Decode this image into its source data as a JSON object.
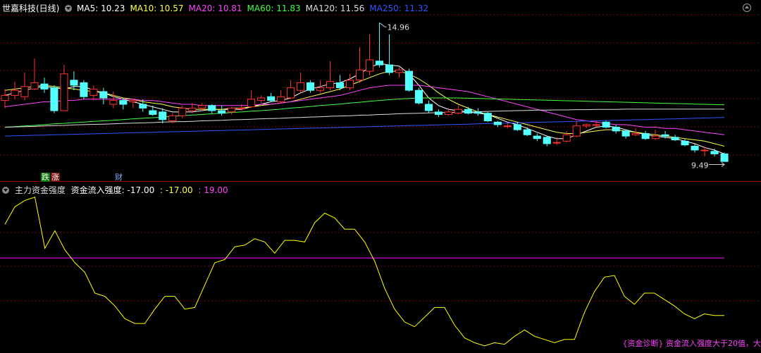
{
  "header_top": {
    "stock": "世嘉科技(日线)",
    "ma": [
      {
        "label": "MA5: 10.23",
        "color": "#ffffff"
      },
      {
        "label": "MA10: 10.57",
        "color": "#ffff44"
      },
      {
        "label": "MA20: 10.81",
        "color": "#ff44ff"
      },
      {
        "label": "MA60: 11.83",
        "color": "#44ff44"
      },
      {
        "label": "MA120: 11.56",
        "color": "#dddddd"
      },
      {
        "label": "MA250: 11.32",
        "color": "#3355ff"
      }
    ]
  },
  "header_bottom": {
    "indicator": "主力资金强度",
    "line1": "资金流入强度: -17.00",
    "line2": ": -17.00",
    "line3": ": 19.00"
  },
  "tags": {
    "die": "跌",
    "zhang": "涨",
    "cai": "财"
  },
  "diagnosis": "{资金诊断} 资金流入强度大于20值，大",
  "colors": {
    "up": "#ff3232",
    "down": "#54ffff",
    "grid": "#800000",
    "flow": "#ffff00",
    "threshold": "#ff00ff"
  },
  "chart_data": [
    {
      "type": "candlestick",
      "high_label": "14.96",
      "low_label": "9.49",
      "ylim": [
        9.2,
        15.3
      ],
      "candles": [
        [
          11.9,
          12.1,
          12.35,
          11.6
        ],
        [
          12.1,
          12.3,
          12.65,
          11.95
        ],
        [
          12.05,
          12.45,
          13.0,
          11.9
        ],
        [
          12.35,
          12.6,
          13.55,
          12.3
        ],
        [
          12.55,
          12.35,
          12.8,
          12.2
        ],
        [
          12.4,
          11.5,
          12.5,
          11.4
        ],
        [
          11.5,
          12.95,
          13.3,
          11.5
        ],
        [
          12.7,
          12.5,
          13.05,
          12.3
        ],
        [
          12.6,
          12.05,
          12.7,
          11.95
        ],
        [
          12.1,
          12.35,
          12.5,
          11.9
        ],
        [
          12.25,
          12.0,
          12.4,
          11.75
        ],
        [
          11.75,
          11.9,
          12.25,
          11.6
        ],
        [
          11.9,
          11.75,
          12.0,
          11.55
        ],
        [
          11.85,
          11.9,
          11.95,
          11.6
        ],
        [
          11.75,
          11.6,
          11.95,
          11.45
        ],
        [
          11.5,
          11.35,
          11.7,
          11.3
        ],
        [
          11.45,
          11.15,
          11.6,
          11.0
        ],
        [
          11.1,
          11.3,
          11.4,
          11.0
        ],
        [
          11.3,
          11.6,
          11.7,
          11.2
        ],
        [
          11.5,
          11.6,
          11.8,
          11.4
        ],
        [
          11.6,
          11.7,
          11.8,
          11.5
        ],
        [
          11.7,
          11.5,
          11.75,
          11.4
        ],
        [
          11.5,
          11.4,
          11.7,
          11.3
        ],
        [
          11.45,
          11.6,
          11.65,
          11.35
        ],
        [
          11.6,
          11.6,
          11.75,
          11.5
        ],
        [
          11.65,
          11.95,
          12.3,
          11.6
        ],
        [
          11.9,
          12.0,
          12.1,
          11.8
        ],
        [
          12.05,
          11.9,
          12.2,
          11.85
        ],
        [
          11.85,
          12.05,
          12.3,
          11.8
        ],
        [
          12.0,
          12.4,
          12.7,
          11.95
        ],
        [
          12.3,
          12.6,
          13.0,
          12.2
        ],
        [
          12.6,
          12.3,
          12.7,
          12.2
        ],
        [
          12.3,
          12.4,
          12.7,
          12.2
        ],
        [
          12.4,
          12.65,
          13.45,
          12.3
        ],
        [
          12.6,
          12.4,
          12.9,
          12.3
        ],
        [
          12.4,
          12.7,
          12.95,
          12.3
        ],
        [
          12.7,
          13.1,
          14.0,
          12.6
        ],
        [
          13.05,
          13.5,
          14.5,
          12.9
        ],
        [
          13.45,
          13.3,
          14.96,
          13.2
        ],
        [
          13.3,
          13.0,
          14.5,
          12.9
        ],
        [
          13.0,
          13.1,
          13.2,
          12.8
        ],
        [
          13.05,
          12.3,
          13.15,
          12.25
        ],
        [
          12.3,
          11.8,
          12.4,
          11.75
        ],
        [
          11.75,
          11.5,
          11.9,
          11.4
        ],
        [
          11.45,
          11.35,
          11.55,
          11.25
        ],
        [
          11.35,
          11.45,
          11.6,
          11.3
        ],
        [
          11.4,
          11.55,
          11.7,
          11.35
        ],
        [
          11.55,
          11.4,
          11.65,
          11.35
        ],
        [
          11.45,
          11.4,
          11.6,
          11.3
        ],
        [
          11.4,
          11.1,
          11.45,
          11.05
        ],
        [
          11.05,
          10.95,
          11.1,
          10.85
        ],
        [
          10.9,
          10.9,
          11.05,
          10.8
        ],
        [
          10.95,
          10.75,
          11.05,
          10.7
        ],
        [
          10.75,
          10.55,
          10.85,
          10.5
        ],
        [
          10.5,
          10.4,
          10.6,
          10.3
        ],
        [
          10.45,
          10.2,
          10.5,
          10.1
        ],
        [
          10.25,
          10.25,
          10.45,
          10.15
        ],
        [
          10.3,
          10.55,
          10.7,
          10.25
        ],
        [
          10.5,
          10.9,
          11.1,
          10.45
        ],
        [
          10.9,
          10.95,
          11.0,
          10.8
        ],
        [
          10.95,
          10.95,
          11.1,
          10.85
        ],
        [
          11.05,
          10.85,
          11.1,
          10.8
        ],
        [
          10.85,
          10.7,
          10.95,
          10.6
        ],
        [
          10.7,
          10.5,
          10.75,
          10.4
        ],
        [
          10.55,
          10.6,
          10.8,
          10.5
        ],
        [
          10.6,
          10.4,
          10.7,
          10.35
        ],
        [
          10.4,
          10.5,
          10.75,
          10.35
        ],
        [
          10.55,
          10.5,
          10.7,
          10.4
        ],
        [
          10.45,
          10.35,
          10.55,
          10.3
        ],
        [
          10.3,
          10.15,
          10.4,
          10.1
        ],
        [
          10.1,
          9.95,
          10.2,
          9.85
        ],
        [
          9.95,
          9.95,
          10.1,
          9.7
        ],
        [
          9.9,
          9.8,
          10.0,
          9.7
        ],
        [
          9.8,
          9.5,
          9.85,
          9.49
        ]
      ],
      "ma_series": [
        {
          "name": "MA5",
          "color": "#ffffff",
          "values": [
            12.1,
            12.2,
            12.3,
            12.4,
            12.45,
            12.4,
            12.35,
            12.45,
            12.45,
            12.3,
            12.2,
            12.05,
            11.95,
            11.85,
            11.75,
            11.65,
            11.55,
            11.45,
            11.45,
            11.45,
            11.5,
            11.55,
            11.55,
            11.55,
            11.55,
            11.65,
            11.75,
            11.85,
            11.9,
            12.0,
            12.2,
            12.35,
            12.45,
            12.55,
            12.6,
            12.75,
            12.95,
            13.2,
            13.35,
            13.3,
            13.25,
            12.95,
            12.5,
            12.0,
            11.7,
            11.55,
            11.5,
            11.45,
            11.4,
            11.35,
            11.2,
            11.05,
            10.95,
            10.8,
            10.65,
            10.5,
            10.4,
            10.4,
            10.55,
            10.7,
            10.85,
            10.9,
            10.85,
            10.75,
            10.65,
            10.55,
            10.5,
            10.45,
            10.4,
            10.3,
            10.2,
            10.05,
            9.95,
            9.8
          ]
        },
        {
          "name": "MA10",
          "color": "#ffff44",
          "values": [
            12.3,
            12.35,
            12.4,
            12.45,
            12.5,
            12.45,
            12.4,
            12.35,
            12.3,
            12.25,
            12.2,
            12.1,
            12.0,
            11.95,
            11.85,
            11.8,
            11.75,
            11.65,
            11.6,
            11.55,
            11.55,
            11.55,
            11.55,
            11.6,
            11.6,
            11.65,
            11.7,
            11.75,
            11.8,
            11.85,
            11.95,
            12.05,
            12.15,
            12.25,
            12.35,
            12.5,
            12.65,
            12.8,
            12.95,
            13.05,
            13.05,
            12.95,
            12.75,
            12.5,
            12.2,
            11.95,
            11.75,
            11.6,
            11.45,
            11.35,
            11.25,
            11.15,
            11.05,
            10.95,
            10.85,
            10.75,
            10.65,
            10.6,
            10.6,
            10.65,
            10.7,
            10.75,
            10.75,
            10.7,
            10.65,
            10.6,
            10.55,
            10.5,
            10.45,
            10.4,
            10.35,
            10.3,
            10.2,
            10.1
          ]
        },
        {
          "name": "MA20",
          "color": "#ff44ff",
          "values": [
            11.65,
            11.7,
            11.75,
            11.8,
            11.85,
            11.85,
            11.9,
            11.9,
            11.95,
            11.95,
            11.95,
            11.95,
            11.95,
            11.95,
            11.9,
            11.9,
            11.85,
            11.8,
            11.75,
            11.75,
            11.7,
            11.7,
            11.7,
            11.7,
            11.7,
            11.7,
            11.75,
            11.75,
            11.8,
            11.85,
            11.9,
            11.95,
            12.0,
            12.05,
            12.1,
            12.2,
            12.3,
            12.4,
            12.45,
            12.5,
            12.5,
            12.5,
            12.5,
            12.45,
            12.4,
            12.35,
            12.3,
            12.25,
            12.15,
            12.05,
            11.95,
            11.85,
            11.75,
            11.65,
            11.55,
            11.45,
            11.35,
            11.25,
            11.15,
            11.1,
            11.05,
            11.0,
            10.95,
            10.95,
            10.9,
            10.85,
            10.85,
            10.8,
            10.8,
            10.75,
            10.7,
            10.65,
            10.6,
            10.55
          ]
        },
        {
          "name": "MA60",
          "color": "#44ff44",
          "values": [
            10.85,
            10.87,
            10.9,
            10.92,
            10.95,
            10.98,
            11.0,
            11.03,
            11.05,
            11.08,
            11.1,
            11.12,
            11.15,
            11.18,
            11.2,
            11.22,
            11.25,
            11.28,
            11.3,
            11.33,
            11.35,
            11.38,
            11.4,
            11.43,
            11.45,
            11.48,
            11.5,
            11.53,
            11.56,
            11.6,
            11.63,
            11.66,
            11.7,
            11.73,
            11.76,
            11.8,
            11.83,
            11.87,
            11.9,
            11.93,
            11.96,
            11.98,
            12.0,
            12.0,
            12.0,
            12.0,
            12.0,
            11.99,
            11.98,
            11.97,
            11.96,
            11.95,
            11.94,
            11.93,
            11.92,
            11.91,
            11.9,
            11.89,
            11.88,
            11.87,
            11.86,
            11.85,
            11.84,
            11.83,
            11.82,
            11.81,
            11.8,
            11.79,
            11.78,
            11.77,
            11.76,
            11.75,
            11.74,
            11.73
          ]
        },
        {
          "name": "MA120",
          "color": "#dddddd",
          "values": [
            10.85,
            10.86,
            10.87,
            10.88,
            10.9,
            10.91,
            10.92,
            10.94,
            10.95,
            10.96,
            10.97,
            10.98,
            11.0,
            11.01,
            11.02,
            11.03,
            11.05,
            11.06,
            11.07,
            11.08,
            11.1,
            11.11,
            11.12,
            11.14,
            11.15,
            11.16,
            11.18,
            11.19,
            11.2,
            11.22,
            11.23,
            11.25,
            11.26,
            11.28,
            11.29,
            11.3,
            11.32,
            11.33,
            11.35,
            11.36,
            11.38,
            11.39,
            11.4,
            11.41,
            11.42,
            11.43,
            11.44,
            11.45,
            11.46,
            11.47,
            11.48,
            11.49,
            11.5,
            11.51,
            11.52,
            11.52,
            11.53,
            11.53,
            11.54,
            11.54,
            11.55,
            11.55,
            11.55,
            11.56,
            11.56,
            11.56,
            11.56,
            11.56,
            11.56,
            11.56,
            11.56,
            11.56,
            11.56,
            11.56
          ]
        },
        {
          "name": "MA250",
          "color": "#3355ff",
          "values": [
            10.5,
            10.51,
            10.52,
            10.53,
            10.54,
            10.55,
            10.56,
            10.57,
            10.58,
            10.59,
            10.6,
            10.61,
            10.62,
            10.63,
            10.64,
            10.65,
            10.66,
            10.67,
            10.68,
            10.69,
            10.7,
            10.71,
            10.72,
            10.73,
            10.74,
            10.75,
            10.76,
            10.77,
            10.78,
            10.79,
            10.8,
            10.81,
            10.82,
            10.83,
            10.84,
            10.85,
            10.86,
            10.87,
            10.88,
            10.89,
            10.9,
            10.91,
            10.92,
            10.93,
            10.94,
            10.95,
            10.96,
            10.97,
            10.98,
            10.99,
            11.0,
            11.01,
            11.02,
            11.03,
            11.04,
            11.05,
            11.06,
            11.07,
            11.08,
            11.09,
            11.1,
            11.11,
            11.12,
            11.13,
            11.14,
            11.15,
            11.16,
            11.17,
            11.18,
            11.19,
            11.2,
            11.21,
            11.22,
            11.23
          ]
        }
      ]
    },
    {
      "type": "line",
      "ylim": [
        -40,
        60
      ],
      "threshold": 19,
      "values": [
        40,
        51,
        55,
        57,
        25,
        36,
        24,
        16,
        10,
        -3,
        -5,
        -11,
        -19,
        -22,
        -22,
        -13,
        -5,
        -5,
        -13,
        -12,
        2,
        16,
        18,
        26,
        27,
        31,
        29,
        22,
        30,
        30,
        29,
        41,
        47,
        44,
        37,
        37,
        29,
        17,
        0,
        -13,
        -21,
        -24,
        -18,
        -12,
        -12,
        -23,
        -31,
        -34,
        -36,
        -34,
        -35,
        -30,
        -26,
        -30,
        -32,
        -34,
        -32,
        -32,
        -15,
        -2,
        7,
        8,
        -5,
        -10,
        -3,
        -3,
        -7,
        -11,
        -16,
        -19,
        -16,
        -17,
        -17
      ]
    }
  ]
}
